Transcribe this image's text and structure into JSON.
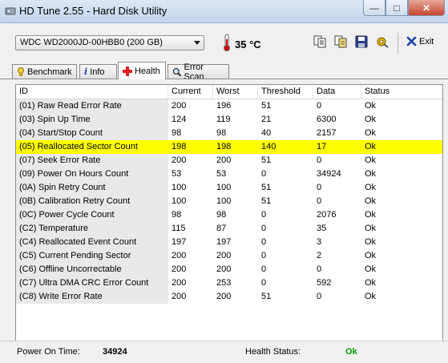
{
  "window": {
    "title": "HD Tune 2.55 - Hard Disk Utility",
    "minimize": "—",
    "maximize": "□",
    "close": "✕"
  },
  "toolbar": {
    "drive": "WDC WD2000JD-00HBB0 (200 GB)",
    "temperature": "35 °C",
    "exit_label": "Exit"
  },
  "tabs": [
    {
      "label": "Benchmark",
      "icon": "benchmark-icon",
      "active": false
    },
    {
      "label": "Info",
      "icon": "info-icon",
      "active": false
    },
    {
      "label": "Health",
      "icon": "health-cross-icon",
      "active": true
    },
    {
      "label": "Error Scan",
      "icon": "magnifier-icon",
      "active": false
    }
  ],
  "table": {
    "columns": [
      "ID",
      "Current",
      "Worst",
      "Threshold",
      "Data",
      "Status"
    ],
    "rows": [
      [
        "(01) Raw Read Error Rate",
        "200",
        "196",
        "51",
        "0",
        "Ok"
      ],
      [
        "(03) Spin Up Time",
        "124",
        "119",
        "21",
        "6300",
        "Ok"
      ],
      [
        "(04) Start/Stop Count",
        "98",
        "98",
        "40",
        "2157",
        "Ok"
      ],
      [
        "(05) Reallocated Sector Count",
        "198",
        "198",
        "140",
        "17",
        "Ok"
      ],
      [
        "(07) Seek Error Rate",
        "200",
        "200",
        "51",
        "0",
        "Ok"
      ],
      [
        "(09) Power On Hours Count",
        "53",
        "53",
        "0",
        "34924",
        "Ok"
      ],
      [
        "(0A) Spin Retry Count",
        "100",
        "100",
        "51",
        "0",
        "Ok"
      ],
      [
        "(0B) Calibration Retry Count",
        "100",
        "100",
        "51",
        "0",
        "Ok"
      ],
      [
        "(0C) Power Cycle Count",
        "98",
        "98",
        "0",
        "2076",
        "Ok"
      ],
      [
        "(C2) Temperature",
        "115",
        "87",
        "0",
        "35",
        "Ok"
      ],
      [
        "(C4) Reallocated Event Count",
        "197",
        "197",
        "0",
        "3",
        "Ok"
      ],
      [
        "(C5) Current Pending Sector",
        "200",
        "200",
        "0",
        "2",
        "Ok"
      ],
      [
        "(C6) Offline Uncorrectable",
        "200",
        "200",
        "0",
        "0",
        "Ok"
      ],
      [
        "(C7) Ultra DMA CRC Error Count",
        "200",
        "253",
        "0",
        "592",
        "Ok"
      ],
      [
        "(C8) Write Error Rate",
        "200",
        "200",
        "51",
        "0",
        "Ok"
      ]
    ],
    "highlight_row": 3,
    "highlight_color": "#ffff00"
  },
  "status_bar": {
    "power_on_label": "Power On Time:",
    "power_on_value": "34924",
    "health_label": "Health Status:",
    "health_value": "Ok",
    "health_color": "#00a000"
  }
}
